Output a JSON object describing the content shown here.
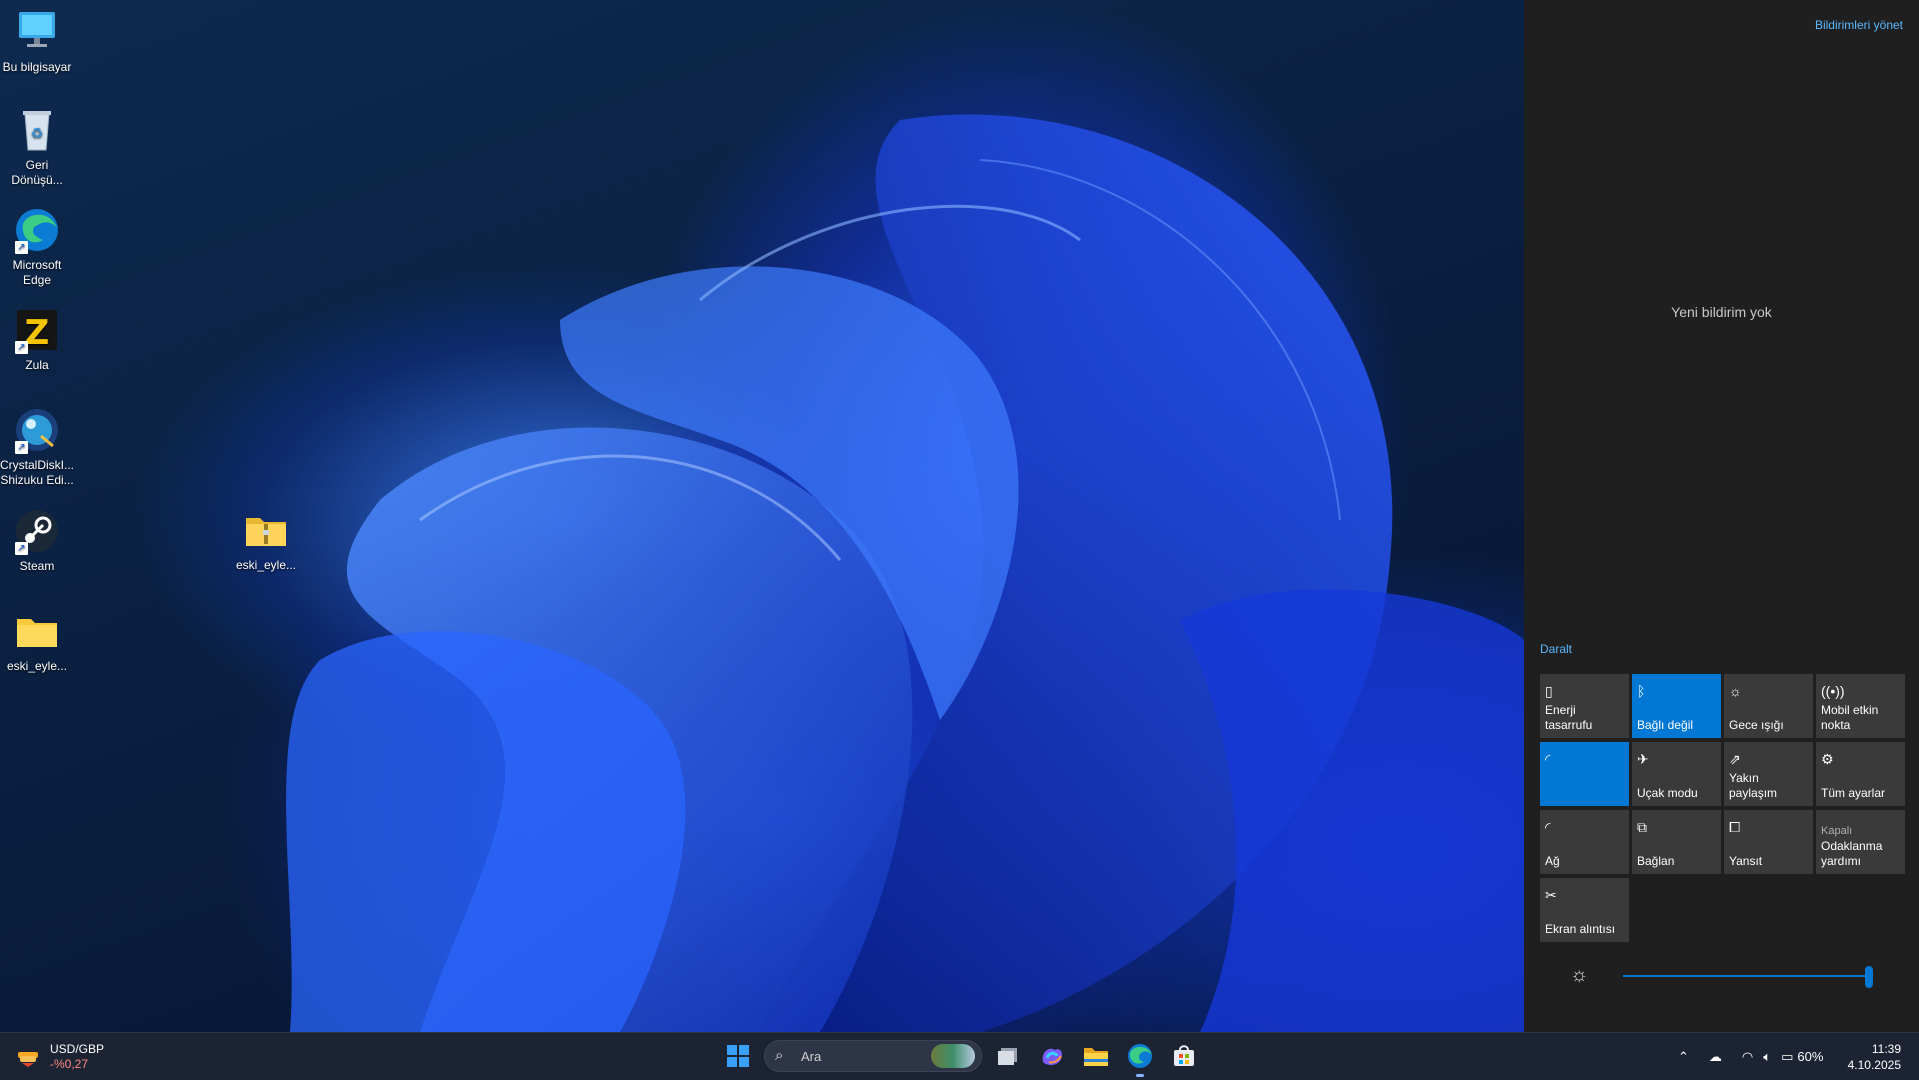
{
  "desktop": {
    "icons": [
      {
        "label": "Bu bilgisayar"
      },
      {
        "label": "Geri Dönüşü..."
      },
      {
        "label": "Microsoft Edge"
      },
      {
        "label": "Zula"
      },
      {
        "label": "CrystalDiskI... Shizuku Edi..."
      },
      {
        "label": "Steam"
      },
      {
        "label": "eski_eyle..."
      },
      {
        "label": "eski_eyle..."
      }
    ]
  },
  "action_center": {
    "manage_link": "Bildirimleri yönet",
    "no_notifications": "Yeni bildirim yok",
    "collapse_link": "Daralt",
    "tiles": [
      {
        "label": "Enerji tasarrufu",
        "icon": "battery-saver-icon",
        "active": false
      },
      {
        "label": "Bağlı değil",
        "icon": "bluetooth-icon",
        "active": true
      },
      {
        "label": "Gece ışığı",
        "icon": "night-light-icon",
        "active": false
      },
      {
        "label": "Mobil etkin nokta",
        "icon": "mobile-hotspot-icon",
        "active": false
      },
      {
        "label": "",
        "icon": "wifi-icon",
        "active": true
      },
      {
        "label": "Uçak modu",
        "icon": "airplane-icon",
        "active": false
      },
      {
        "label": "Yakın paylaşım",
        "icon": "nearby-share-icon",
        "active": false
      },
      {
        "label": "Tüm ayarlar",
        "icon": "settings-gear-icon",
        "active": false
      },
      {
        "label": "Ağ",
        "icon": "network-icon",
        "active": false
      },
      {
        "label": "Bağlan",
        "icon": "connect-icon",
        "active": false
      },
      {
        "label": "Yansıt",
        "icon": "project-icon",
        "active": false
      },
      {
        "label": "Odaklanma yardımı",
        "sub": "Kapalı",
        "icon": "focus-assist-icon",
        "active": false
      },
      {
        "label": "Ekran alıntısı",
        "icon": "screen-snip-icon",
        "active": false
      }
    ],
    "brightness_percent": 100
  },
  "taskbar": {
    "widget": {
      "title": "USD/GBP",
      "value": "-%0,27"
    },
    "search_placeholder": "Ara",
    "apps": [
      "task-view-icon",
      "m365-copilot-icon",
      "file-explorer-icon",
      "edge-icon",
      "store-icon"
    ],
    "tray": {
      "battery": "60%",
      "time": "11:39",
      "date": "4.10.2025"
    }
  },
  "colors": {
    "accent": "#0078d4",
    "link": "#5cb8ff",
    "tile_bg": "#3a3a3a",
    "panel_bg": "#1f1f1f",
    "taskbar_bg": "#1c2333",
    "widget_negative": "#ff8a80"
  }
}
